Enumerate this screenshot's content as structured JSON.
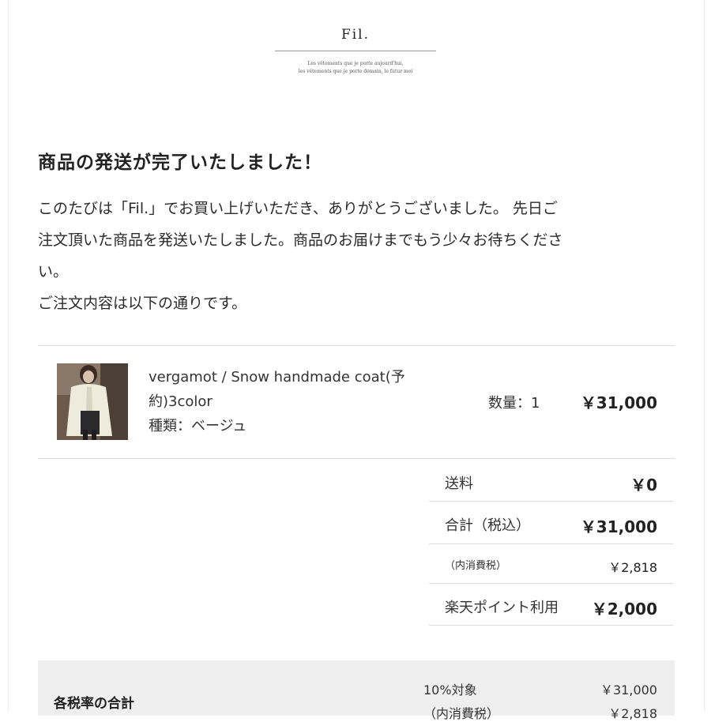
{
  "header": {
    "logo": "Fil.",
    "tagline_1": "Les vêtements que je porte aujourd'hui,",
    "tagline_2": "les vêtements que je porte demain, le futur moi"
  },
  "heading": "商品の発送が完了いたしました！",
  "message": {
    "line_1": "このたびは「Fil.」でお買い上げいただき、ありがとうございました。 先日ご",
    "line_2": "注文頂いた商品を発送いたしました。商品のお届けまでもう少々お待ちくださ",
    "line_3": "い。",
    "line_4": "ご注文内容は以下の通りです。"
  },
  "item": {
    "thumbnail": "product-photo",
    "name_line_1": "vergamot / Snow handmade coat(予",
    "name_line_2": "約)3color",
    "variant": "種類：ベージュ",
    "quantity": "数量：1",
    "price": "￥31,000"
  },
  "summary": [
    {
      "label": "送料",
      "value": "￥0"
    },
    {
      "label": "合計（税込）",
      "value": "￥31,000"
    },
    {
      "label": "（内消費税）",
      "value": "￥2,818"
    },
    {
      "label": "楽天ポイント利用",
      "value": "￥2,000"
    }
  ],
  "tax": {
    "title": "各税率の合計",
    "rows": [
      {
        "label": "10%対象",
        "value": "￥31,000"
      },
      {
        "label": "（内消費税）",
        "value": "￥2,818"
      }
    ]
  },
  "colors": {
    "text": "#2b2b2b",
    "divider": "#dcdcdc",
    "tax_box_bg": "#efefef"
  }
}
